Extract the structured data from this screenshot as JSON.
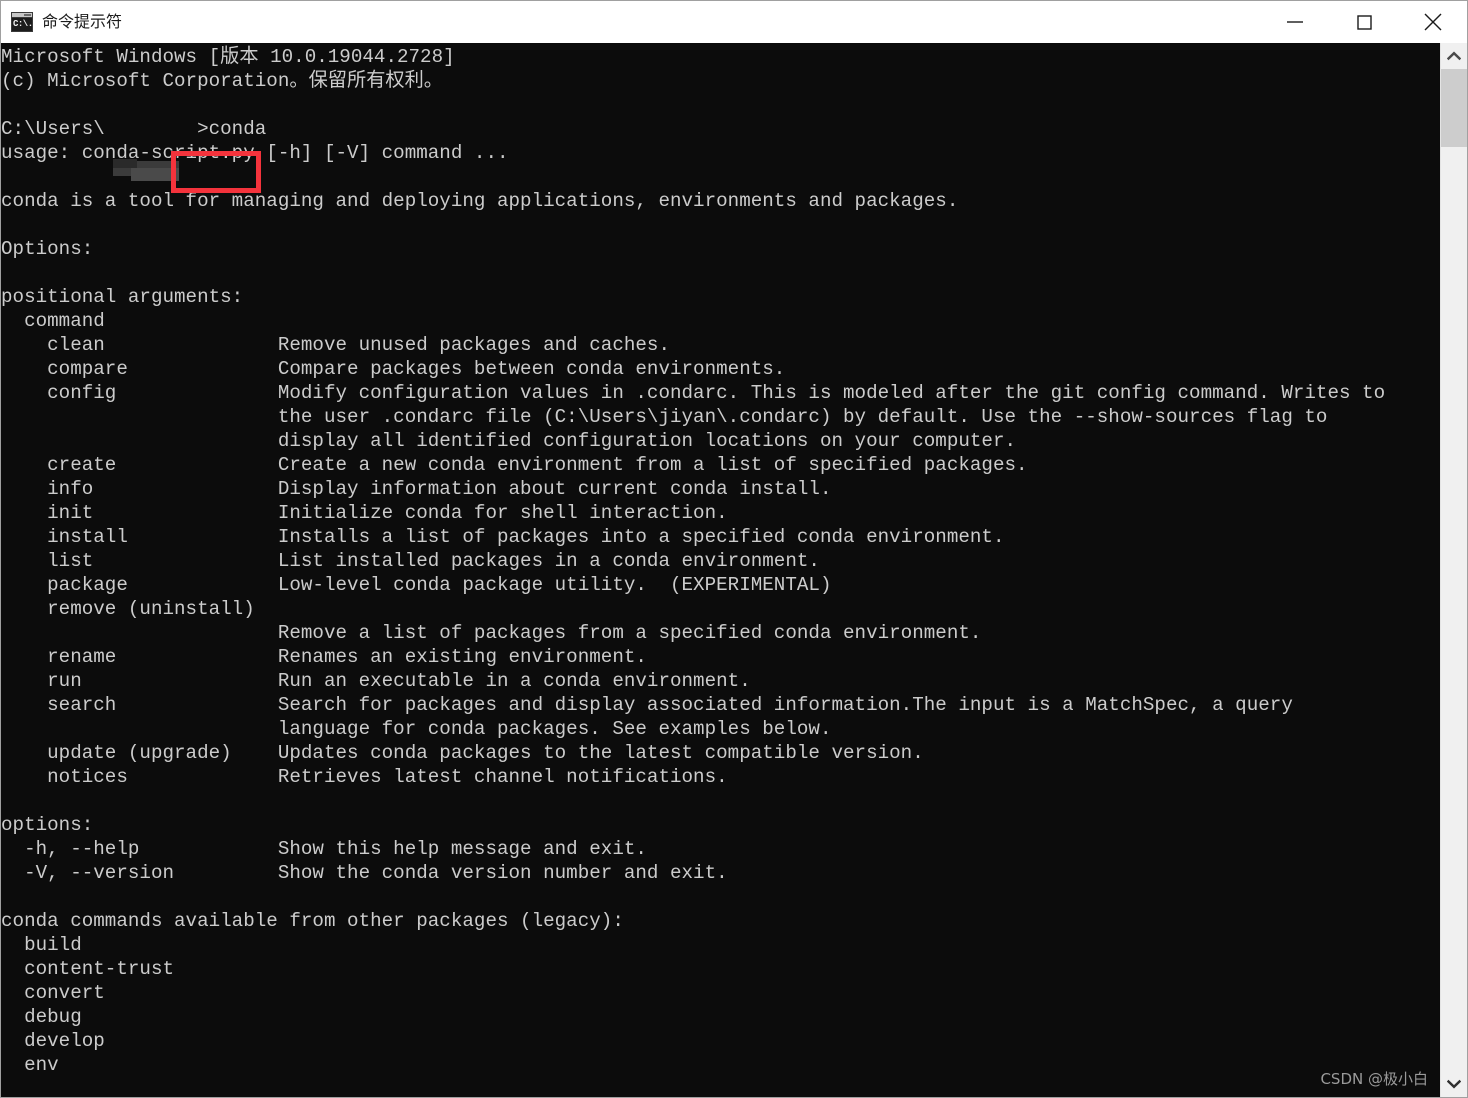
{
  "window": {
    "title": "命令提示符",
    "icon_name": "cmd-icon",
    "icon_text": "C:\\.",
    "controls": {
      "minimize_label": "最小化",
      "maximize_label": "最大化",
      "close_label": "关闭"
    }
  },
  "colors": {
    "console_background": "#0c0c0c",
    "console_foreground": "#cccccc",
    "highlight_red": "#f4333c",
    "titlebar_background": "#ffffff",
    "scrollbar_track": "#f0f0f0",
    "scrollbar_thumb": "#cdcdcd"
  },
  "console": {
    "prompt_path": "C:\\Users\\",
    "typed_command": "conda",
    "highlighted_command": "conda",
    "lines": [
      "Microsoft Windows [版本 10.0.19044.2728]",
      "(c) Microsoft Corporation。保留所有权利。",
      "",
      "C:\\Users\\        >conda",
      "usage: conda-script.py [-h] [-V] command ...",
      "",
      "conda is a tool for managing and deploying applications, environments and packages.",
      "",
      "Options:",
      "",
      "positional arguments:",
      "  command",
      "    clean               Remove unused packages and caches.",
      "    compare             Compare packages between conda environments.",
      "    config              Modify configuration values in .condarc. This is modeled after the git config command. Writes to",
      "                        the user .condarc file (C:\\Users\\jiyan\\.condarc) by default. Use the --show-sources flag to",
      "                        display all identified configuration locations on your computer.",
      "    create              Create a new conda environment from a list of specified packages.",
      "    info                Display information about current conda install.",
      "    init                Initialize conda for shell interaction.",
      "    install             Installs a list of packages into a specified conda environment.",
      "    list                List installed packages in a conda environment.",
      "    package             Low-level conda package utility.  (EXPERIMENTAL)",
      "    remove (uninstall)",
      "                        Remove a list of packages from a specified conda environment.",
      "    rename              Renames an existing environment.",
      "    run                 Run an executable in a conda environment.",
      "    search              Search for packages and display associated information.The input is a MatchSpec, a query",
      "                        language for conda packages. See examples below.",
      "    update (upgrade)    Updates conda packages to the latest compatible version.",
      "    notices             Retrieves latest channel notifications.",
      "",
      "options:",
      "  -h, --help            Show this help message and exit.",
      "  -V, --version         Show the conda version number and exit.",
      "",
      "conda commands available from other packages (legacy):",
      "  build",
      "  content-trust",
      "  convert",
      "  debug",
      "  develop",
      "  env"
    ]
  },
  "scrollbar": {
    "up_arrow_label": "向上滚动",
    "down_arrow_label": "向下滚动",
    "thumb_label": "滚动条滑块"
  },
  "watermark": {
    "text": "CSDN @极小白"
  }
}
